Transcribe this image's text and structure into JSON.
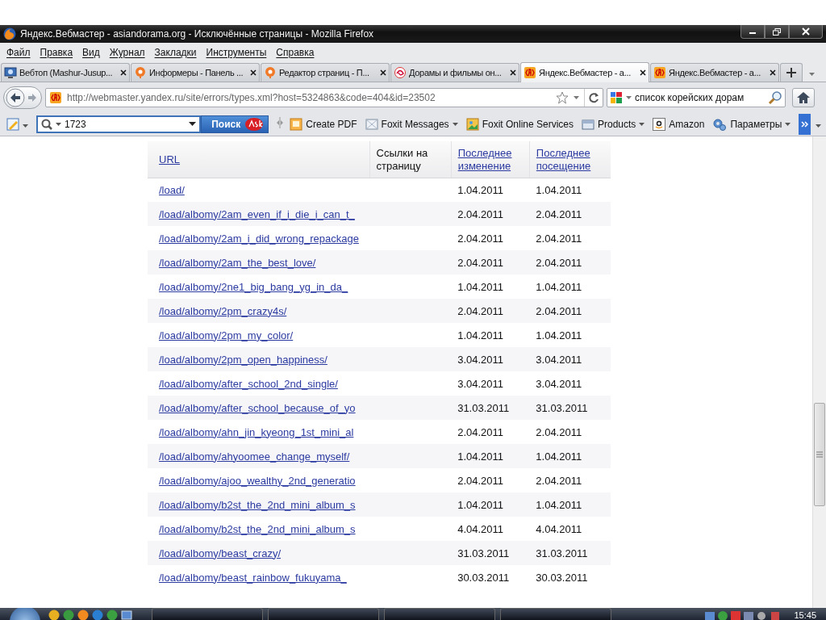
{
  "window": {
    "title": "Яндекс.Вебмастер - asiandorama.org - Исключённые страницы - Mozilla Firefox"
  },
  "menu": [
    "Файл",
    "Правка",
    "Вид",
    "Журнал",
    "Закладки",
    "Инструменты",
    "Справка"
  ],
  "tabs": [
    {
      "label": "Вебтоп (Mashur-Jusup...",
      "selected": false
    },
    {
      "label": "Информеры - Панель ...",
      "selected": false
    },
    {
      "label": "Редактор страниц - П...",
      "selected": false
    },
    {
      "label": "Дорамы и фильмы он...",
      "selected": false
    },
    {
      "label": "Яндекс.Вебмастер - а...",
      "selected": true
    },
    {
      "label": "Яндекс.Вебмастер - а...",
      "selected": false
    }
  ],
  "address_bar": {
    "url": "http://webmaster.yandex.ru/site/errors/types.xml?host=5324863&code=404&id=23502"
  },
  "search_field": {
    "value": "список корейских дорам"
  },
  "ask_toolbar": {
    "search_value": "1723",
    "search_button": "Поиск",
    "items": [
      {
        "label": "Create PDF",
        "dropdown": false
      },
      {
        "label": "Foxit Messages",
        "dropdown": true
      },
      {
        "label": "Foxit Online Services",
        "dropdown": false
      },
      {
        "label": "Products",
        "dropdown": true
      },
      {
        "label": "Amazon",
        "dropdown": false
      }
    ],
    "settings": "Параметры"
  },
  "table": {
    "columns": [
      {
        "label": "URL",
        "sortable": true
      },
      {
        "label": "Ссылки на страницу",
        "sortable": false
      },
      {
        "label": "Последнее изменение",
        "sortable": true
      },
      {
        "label": "Последнее посещение",
        "sortable": true
      }
    ],
    "rows": [
      {
        "url": "/load/",
        "last_change": "1.04.2011",
        "last_visit": "1.04.2011"
      },
      {
        "url": "/load/albomy/2am_even_if_i_die_i_can_t_",
        "last_change": "2.04.2011",
        "last_visit": "2.04.2011"
      },
      {
        "url": "/load/albomy/2am_i_did_wrong_repackage",
        "last_change": "2.04.2011",
        "last_visit": "2.04.2011"
      },
      {
        "url": "/load/albomy/2am_the_best_love/",
        "last_change": "2.04.2011",
        "last_visit": "2.04.2011"
      },
      {
        "url": "/load/albomy/2ne1_big_bang_yg_in_da_",
        "last_change": "1.04.2011",
        "last_visit": "1.04.2011"
      },
      {
        "url": "/load/albomy/2pm_crazy4s/",
        "last_change": "2.04.2011",
        "last_visit": "2.04.2011"
      },
      {
        "url": "/load/albomy/2pm_my_color/",
        "last_change": "1.04.2011",
        "last_visit": "1.04.2011"
      },
      {
        "url": "/load/albomy/2pm_open_happiness/",
        "last_change": "3.04.2011",
        "last_visit": "3.04.2011"
      },
      {
        "url": "/load/albomy/after_school_2nd_single/",
        "last_change": "3.04.2011",
        "last_visit": "3.04.2011"
      },
      {
        "url": "/load/albomy/after_school_because_of_yo",
        "last_change": "31.03.2011",
        "last_visit": "31.03.2011"
      },
      {
        "url": "/load/albomy/ahn_jin_kyeong_1st_mini_al",
        "last_change": "2.04.2011",
        "last_visit": "2.04.2011"
      },
      {
        "url": "/load/albomy/ahyoomee_change_myself/",
        "last_change": "1.04.2011",
        "last_visit": "1.04.2011"
      },
      {
        "url": "/load/albomy/ajoo_wealthy_2nd_generatio",
        "last_change": "2.04.2011",
        "last_visit": "2.04.2011"
      },
      {
        "url": "/load/albomy/b2st_the_2nd_mini_album_s",
        "last_change": "1.04.2011",
        "last_visit": "1.04.2011"
      },
      {
        "url": "/load/albomy/b2st_the_2nd_mini_album_s",
        "last_change": "4.04.2011",
        "last_visit": "4.04.2011"
      },
      {
        "url": "/load/albomy/beast_crazy/",
        "last_change": "31.03.2011",
        "last_visit": "31.03.2011"
      },
      {
        "url": "/load/albomy/beast_rainbow_fukuyama_",
        "last_change": "30.03.2011",
        "last_visit": "30.03.2011"
      }
    ]
  },
  "taskbar": {
    "clock": "15:45"
  }
}
